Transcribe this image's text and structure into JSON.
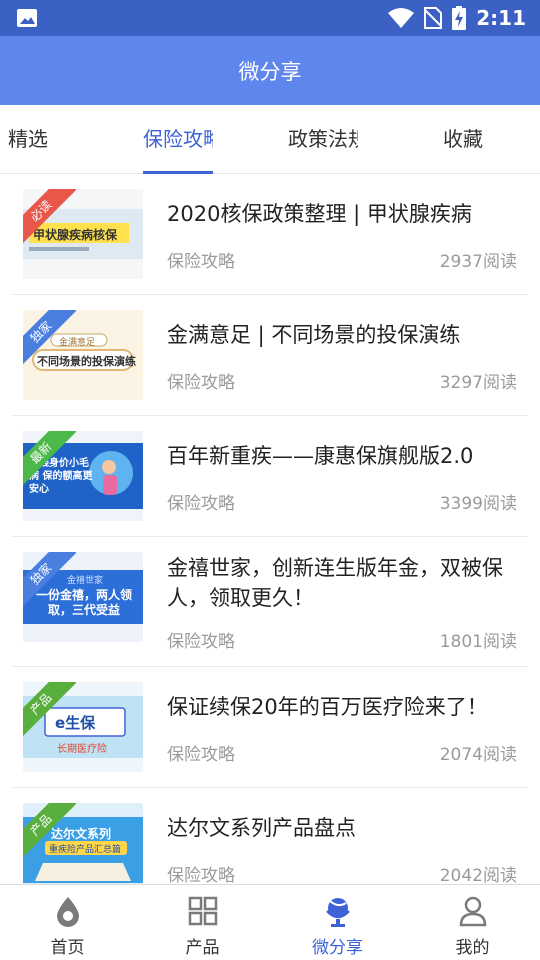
{
  "status_bar": {
    "time": "2:11"
  },
  "app_bar": {
    "title": "微分享"
  },
  "tabs": [
    {
      "label": "精选",
      "active": false
    },
    {
      "label": "保险攻略",
      "active": true
    },
    {
      "label": "政策法规",
      "active": false
    },
    {
      "label": "收藏",
      "active": false
    }
  ],
  "articles": [
    {
      "title": "2020核保政策整理 | 甲状腺疾病",
      "badge": "必读",
      "badge_color": "#e8574a",
      "thumb_text": "甲状腺疾病核保",
      "category": "保险攻略",
      "reads": "2937阅读"
    },
    {
      "title": "金满意足 | 不同场景的投保演练",
      "badge": "独家",
      "badge_color": "#4a7fe0",
      "thumb_text": "不同场景的投保演练",
      "thumb_subtext": "金满意足",
      "category": "保险攻略",
      "reads": "3297阅读"
    },
    {
      "title": "百年新重疾——康惠保旗舰版2.0",
      "badge": "最新",
      "badge_color": "#4cb84a",
      "thumb_text": "小钱身价小毛病 保的额高更安心",
      "category": "保险攻略",
      "reads": "3399阅读"
    },
    {
      "title": "金禧世家，创新连生版年金，双被保人，领取更久！",
      "badge": "独家",
      "badge_color": "#4a7fe0",
      "thumb_text": "一份金禧，两人领取，三代受益",
      "thumb_subtext": "金禧世家",
      "category": "保险攻略",
      "reads": "1801阅读"
    },
    {
      "title": "保证续保20年的百万医疗险来了！",
      "badge": "产品",
      "badge_color": "#5aae3e",
      "thumb_text": "e生保",
      "thumb_subtext": "长期医疗险",
      "category": "保险攻略",
      "reads": "2074阅读"
    },
    {
      "title": "达尔文系列产品盘点",
      "badge": "产品",
      "badge_color": "#5aae3e",
      "thumb_text": "达尔文系列",
      "thumb_subtext": "重疾险产品汇总篇",
      "category": "保险攻略",
      "reads": "2042阅读"
    }
  ],
  "bottom_nav": [
    {
      "label": "首页",
      "icon": "home-drop-icon",
      "active": false
    },
    {
      "label": "产品",
      "icon": "grid-icon",
      "active": false
    },
    {
      "label": "微分享",
      "icon": "globe-icon",
      "active": true
    },
    {
      "label": "我的",
      "icon": "person-icon",
      "active": false
    }
  ],
  "colors": {
    "status_bar": "#3b61c5",
    "app_bar": "#5f86ec",
    "accent": "#3d63d6"
  }
}
